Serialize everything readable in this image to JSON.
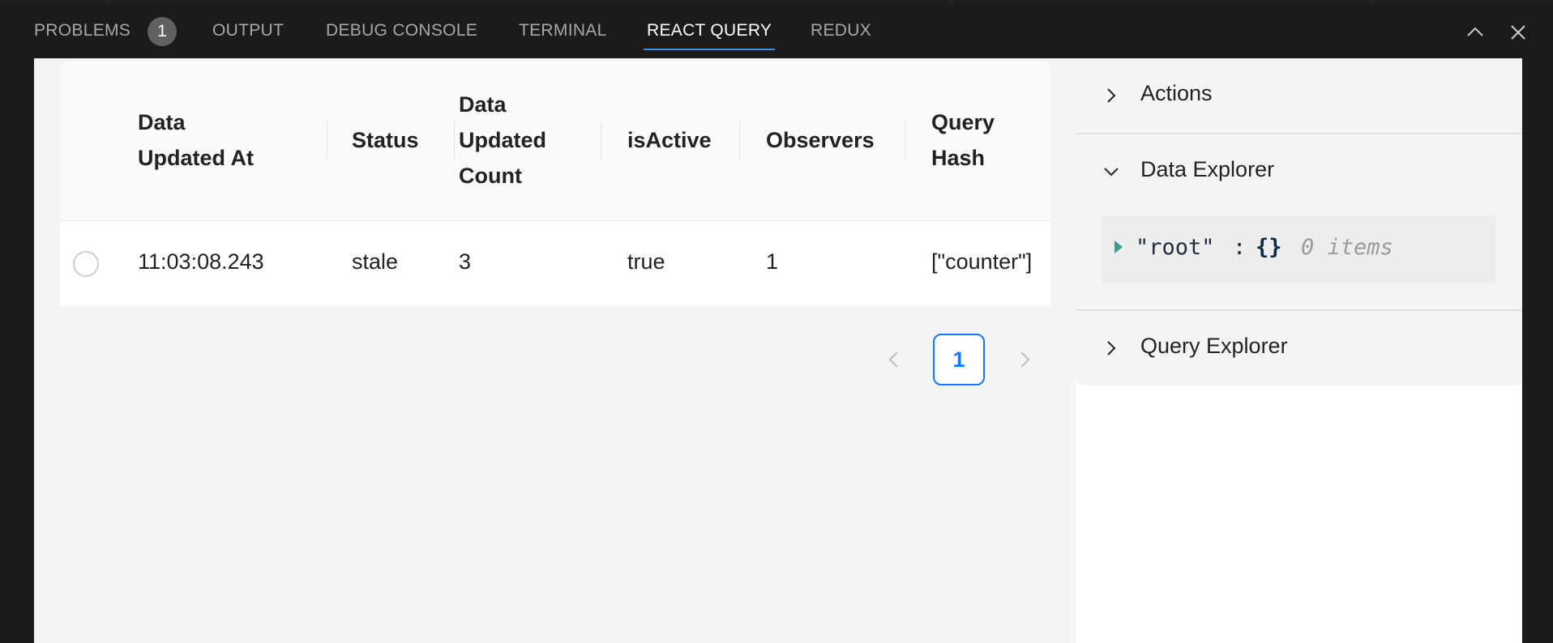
{
  "panel": {
    "tabs": [
      {
        "label": "PROBLEMS",
        "badge": "1"
      },
      {
        "label": "OUTPUT"
      },
      {
        "label": "DEBUG CONSOLE"
      },
      {
        "label": "TERMINAL"
      },
      {
        "label": "REACT QUERY",
        "active": true
      },
      {
        "label": "REDUX"
      }
    ],
    "icons": {
      "maximize": "chevron-up-icon",
      "close": "close-icon"
    }
  },
  "table": {
    "headers": {
      "data_updated_at": [
        "Data",
        "Updated At"
      ],
      "status": [
        "Status"
      ],
      "data_updated_count": [
        "Data",
        "Updated",
        "Count"
      ],
      "is_active": [
        "isActive"
      ],
      "observers": [
        "Observers"
      ],
      "query_hash": [
        "Query",
        "Hash"
      ]
    },
    "rows": [
      {
        "data_updated_at": "11:03:08.243",
        "status": "stale",
        "data_updated_count": "3",
        "is_active": "true",
        "observers": "1",
        "query_hash": "[\"counter\"]"
      }
    ]
  },
  "pagination": {
    "current_page": "1",
    "icons": {
      "prev": "chevron-left-icon",
      "next": "chevron-right-icon"
    }
  },
  "side_panel": {
    "sections": [
      {
        "title": "Actions",
        "expanded": false
      },
      {
        "title": "Data Explorer",
        "expanded": true
      },
      {
        "title": "Query Explorer",
        "expanded": false
      }
    ],
    "data_explorer": {
      "key": "\"root\"",
      "colon": ":",
      "value": "{}",
      "count": "0 items"
    }
  },
  "colors": {
    "accent_tab": "#3b8eea",
    "pagination_active": "#1677ff",
    "panel_background": "#1b1b1b",
    "webview_background": "#f4f4f4"
  }
}
